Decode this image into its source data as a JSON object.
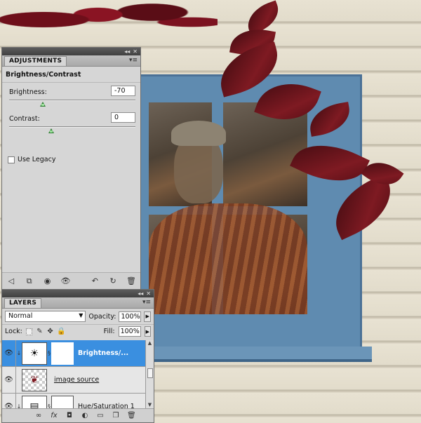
{
  "adjustments": {
    "tab_label": "ADJUSTMENTS",
    "title": "Brightness/Contrast",
    "brightness": {
      "label": "Brightness:",
      "value": "-70",
      "level": -70,
      "min": -150,
      "max": 150
    },
    "contrast": {
      "label": "Contrast:",
      "value": "0",
      "level": 0,
      "min": -50,
      "max": 100
    },
    "use_legacy": {
      "label": "Use Legacy",
      "checked": false
    },
    "footer_icons": [
      "return-arrow-icon",
      "clip-to-layer-icon",
      "visibility-toggle-icon",
      "eye-icon",
      "previous-state-icon",
      "reset-icon",
      "delete-icon"
    ]
  },
  "layers": {
    "tab_label": "LAYERS",
    "blend_mode": "Normal",
    "opacity_label": "Opacity:",
    "opacity_value": "100%",
    "lock_label": "Lock:",
    "fill_label": "Fill:",
    "fill_value": "100%",
    "items": [
      {
        "name": "Brightness/...",
        "selected": true,
        "type": "adjustment"
      },
      {
        "name": "image source",
        "selected": false,
        "type": "pixel"
      },
      {
        "name": "Hue/Saturation 1",
        "selected": false,
        "type": "adjustment"
      }
    ],
    "footer_icons": [
      "link-layers-icon",
      "fx-icon",
      "add-mask-icon",
      "new-adjustment-icon",
      "new-group-icon",
      "new-layer-icon",
      "delete-layer-icon"
    ]
  },
  "colors": {
    "selection": "#3a8fe0",
    "panel_bg": "#d6d6d6",
    "window_frame": "#5f8bb0"
  }
}
